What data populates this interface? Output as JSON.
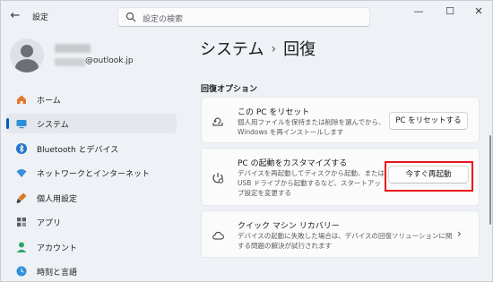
{
  "window": {
    "app_title": "設定",
    "minimize": "—",
    "maximize": "☐",
    "close": "✕"
  },
  "search": {
    "placeholder": "設定の検索"
  },
  "account": {
    "email_domain": "@outlook.jp"
  },
  "sidebar": {
    "items": [
      {
        "label": "ホーム",
        "icon": "home-icon",
        "active": false
      },
      {
        "label": "システム",
        "icon": "system-icon",
        "active": true
      },
      {
        "label": "Bluetooth とデバイス",
        "icon": "bluetooth-icon",
        "active": false
      },
      {
        "label": "ネットワークとインターネット",
        "icon": "wifi-icon",
        "active": false
      },
      {
        "label": "個人用設定",
        "icon": "brush-icon",
        "active": false
      },
      {
        "label": "アプリ",
        "icon": "apps-icon",
        "active": false
      },
      {
        "label": "アカウント",
        "icon": "account-icon",
        "active": false
      },
      {
        "label": "時刻と言語",
        "icon": "clock-globe-icon",
        "active": false
      }
    ]
  },
  "breadcrumb": {
    "parent": "システム",
    "separator": "›",
    "current": "回復"
  },
  "recovery": {
    "heading": "回復オプション",
    "options": [
      {
        "title": "この PC をリセット",
        "description": "個人用ファイルを保持または削除を選んでから、Windows を再インストールします",
        "button": "PC をリセットする",
        "icon": "reset-pc-icon"
      },
      {
        "title": "PC の起動をカスタマイズする",
        "description": "デバイスを再起動してディスクから起動、または USB ドライブから起動するなど、スタートアップ設定を変更する",
        "button": "今すぐ再起動",
        "icon": "advanced-startup-icon"
      },
      {
        "title": "クイック マシン リカバリー",
        "description": "デバイスの起動に失敗した場合は、デバイスの回復ソリューションに関する問題の解決が試行されます",
        "icon": "cloud-icon",
        "chevron": "›"
      }
    ]
  },
  "colors": {
    "accent": "#005fb8",
    "highlight": "#e8141b",
    "background": "#eef1f6",
    "card": "#fbfbfc"
  }
}
